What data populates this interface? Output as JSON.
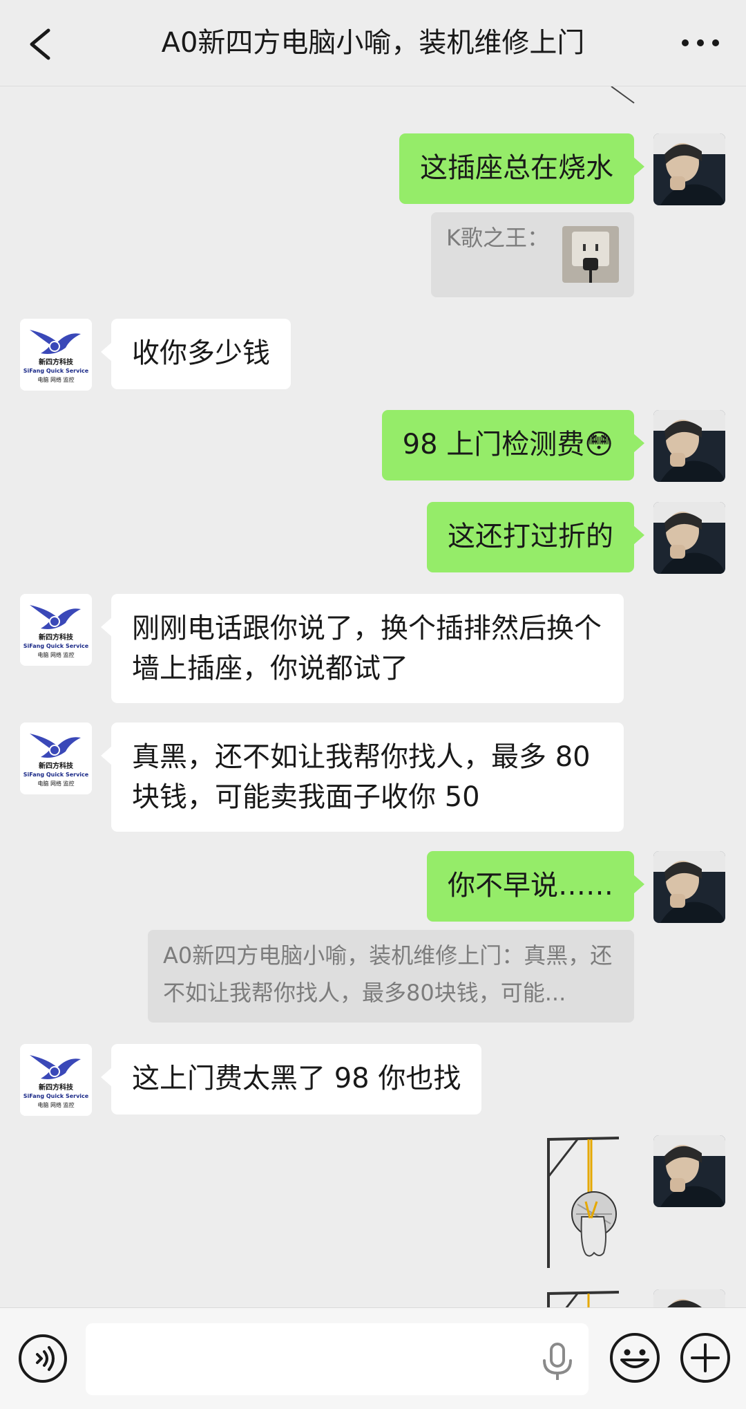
{
  "header": {
    "title": "A0新四方电脑小喻，装机维修上门",
    "back_icon": "chevron-left-icon",
    "more_icon": "more-dots-icon"
  },
  "peer": {
    "logo_text_cn": "新四方科技",
    "logo_text_en": "SiFang Quick Service",
    "logo_tagline": "电脑 网络 监控"
  },
  "messages": [
    {
      "from": "self",
      "type": "text",
      "text": "这插座总在烧水"
    },
    {
      "from": "self",
      "type": "quote",
      "text": "K歌之王："
    },
    {
      "from": "peer",
      "type": "text",
      "text": "收你多少钱"
    },
    {
      "from": "self",
      "type": "text",
      "text": "98 上门检测费",
      "emoji": "😳"
    },
    {
      "from": "self",
      "type": "text",
      "text": "这还打过折的"
    },
    {
      "from": "peer",
      "type": "text",
      "text": "刚刚电话跟你说了，换个插排然后换个墙上插座，你说都试了"
    },
    {
      "from": "peer",
      "type": "text",
      "text": "真黑，还不如让我帮你找人，最多 80 块钱，可能卖我面子收你 50"
    },
    {
      "from": "self",
      "type": "text",
      "text": "你不早说……"
    },
    {
      "from": "self",
      "type": "quote",
      "text": "A0新四方电脑小喻，装机维修上门：真黑，还不如让我帮你找人，最多80块钱，可能..."
    },
    {
      "from": "peer",
      "type": "text",
      "text": "这上门费太黑了 98 你也找"
    },
    {
      "from": "self",
      "type": "sticker",
      "icon": "hanging-figure-sticker"
    },
    {
      "from": "self",
      "type": "sticker",
      "icon": "hanging-figure-sticker"
    }
  ],
  "input_bar": {
    "voice_icon": "voice-icon",
    "placeholder": "",
    "mic_icon": "mic-icon",
    "emoji_icon": "emoji-icon",
    "plus_icon": "plus-icon"
  }
}
